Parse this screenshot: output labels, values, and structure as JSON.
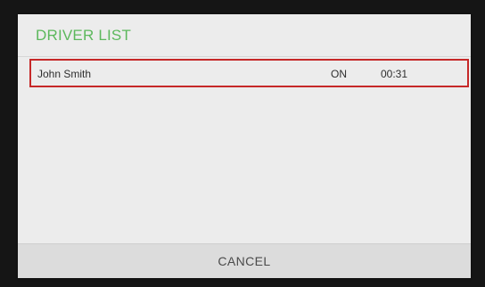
{
  "dialog": {
    "title": "DRIVER LIST",
    "cancel_label": "CANCEL"
  },
  "drivers": [
    {
      "name": "John Smith",
      "status": "ON",
      "time": "00:31"
    }
  ],
  "colors": {
    "title_green": "#5cb85c",
    "selection_red": "#c62828",
    "dialog_bg": "#ececec",
    "backdrop": "#151515"
  }
}
